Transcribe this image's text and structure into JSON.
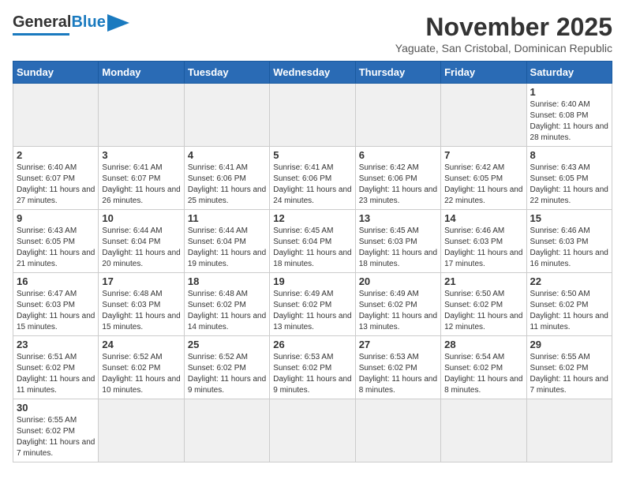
{
  "header": {
    "logo_general": "General",
    "logo_blue": "Blue",
    "month_title": "November 2025",
    "subtitle": "Yaguate, San Cristobal, Dominican Republic"
  },
  "weekdays": [
    "Sunday",
    "Monday",
    "Tuesday",
    "Wednesday",
    "Thursday",
    "Friday",
    "Saturday"
  ],
  "weeks": [
    [
      {
        "day": "",
        "empty": true
      },
      {
        "day": "",
        "empty": true
      },
      {
        "day": "",
        "empty": true
      },
      {
        "day": "",
        "empty": true
      },
      {
        "day": "",
        "empty": true
      },
      {
        "day": "",
        "empty": true
      },
      {
        "day": "1",
        "sunrise": "Sunrise: 6:40 AM",
        "sunset": "Sunset: 6:08 PM",
        "daylight": "Daylight: 11 hours and 28 minutes."
      }
    ],
    [
      {
        "day": "2",
        "sunrise": "Sunrise: 6:40 AM",
        "sunset": "Sunset: 6:07 PM",
        "daylight": "Daylight: 11 hours and 27 minutes."
      },
      {
        "day": "3",
        "sunrise": "Sunrise: 6:41 AM",
        "sunset": "Sunset: 6:07 PM",
        "daylight": "Daylight: 11 hours and 26 minutes."
      },
      {
        "day": "4",
        "sunrise": "Sunrise: 6:41 AM",
        "sunset": "Sunset: 6:06 PM",
        "daylight": "Daylight: 11 hours and 25 minutes."
      },
      {
        "day": "5",
        "sunrise": "Sunrise: 6:41 AM",
        "sunset": "Sunset: 6:06 PM",
        "daylight": "Daylight: 11 hours and 24 minutes."
      },
      {
        "day": "6",
        "sunrise": "Sunrise: 6:42 AM",
        "sunset": "Sunset: 6:06 PM",
        "daylight": "Daylight: 11 hours and 23 minutes."
      },
      {
        "day": "7",
        "sunrise": "Sunrise: 6:42 AM",
        "sunset": "Sunset: 6:05 PM",
        "daylight": "Daylight: 11 hours and 22 minutes."
      },
      {
        "day": "8",
        "sunrise": "Sunrise: 6:43 AM",
        "sunset": "Sunset: 6:05 PM",
        "daylight": "Daylight: 11 hours and 22 minutes."
      }
    ],
    [
      {
        "day": "9",
        "sunrise": "Sunrise: 6:43 AM",
        "sunset": "Sunset: 6:05 PM",
        "daylight": "Daylight: 11 hours and 21 minutes."
      },
      {
        "day": "10",
        "sunrise": "Sunrise: 6:44 AM",
        "sunset": "Sunset: 6:04 PM",
        "daylight": "Daylight: 11 hours and 20 minutes."
      },
      {
        "day": "11",
        "sunrise": "Sunrise: 6:44 AM",
        "sunset": "Sunset: 6:04 PM",
        "daylight": "Daylight: 11 hours and 19 minutes."
      },
      {
        "day": "12",
        "sunrise": "Sunrise: 6:45 AM",
        "sunset": "Sunset: 6:04 PM",
        "daylight": "Daylight: 11 hours and 18 minutes."
      },
      {
        "day": "13",
        "sunrise": "Sunrise: 6:45 AM",
        "sunset": "Sunset: 6:03 PM",
        "daylight": "Daylight: 11 hours and 18 minutes."
      },
      {
        "day": "14",
        "sunrise": "Sunrise: 6:46 AM",
        "sunset": "Sunset: 6:03 PM",
        "daylight": "Daylight: 11 hours and 17 minutes."
      },
      {
        "day": "15",
        "sunrise": "Sunrise: 6:46 AM",
        "sunset": "Sunset: 6:03 PM",
        "daylight": "Daylight: 11 hours and 16 minutes."
      }
    ],
    [
      {
        "day": "16",
        "sunrise": "Sunrise: 6:47 AM",
        "sunset": "Sunset: 6:03 PM",
        "daylight": "Daylight: 11 hours and 15 minutes."
      },
      {
        "day": "17",
        "sunrise": "Sunrise: 6:48 AM",
        "sunset": "Sunset: 6:03 PM",
        "daylight": "Daylight: 11 hours and 15 minutes."
      },
      {
        "day": "18",
        "sunrise": "Sunrise: 6:48 AM",
        "sunset": "Sunset: 6:02 PM",
        "daylight": "Daylight: 11 hours and 14 minutes."
      },
      {
        "day": "19",
        "sunrise": "Sunrise: 6:49 AM",
        "sunset": "Sunset: 6:02 PM",
        "daylight": "Daylight: 11 hours and 13 minutes."
      },
      {
        "day": "20",
        "sunrise": "Sunrise: 6:49 AM",
        "sunset": "Sunset: 6:02 PM",
        "daylight": "Daylight: 11 hours and 13 minutes."
      },
      {
        "day": "21",
        "sunrise": "Sunrise: 6:50 AM",
        "sunset": "Sunset: 6:02 PM",
        "daylight": "Daylight: 11 hours and 12 minutes."
      },
      {
        "day": "22",
        "sunrise": "Sunrise: 6:50 AM",
        "sunset": "Sunset: 6:02 PM",
        "daylight": "Daylight: 11 hours and 11 minutes."
      }
    ],
    [
      {
        "day": "23",
        "sunrise": "Sunrise: 6:51 AM",
        "sunset": "Sunset: 6:02 PM",
        "daylight": "Daylight: 11 hours and 11 minutes."
      },
      {
        "day": "24",
        "sunrise": "Sunrise: 6:52 AM",
        "sunset": "Sunset: 6:02 PM",
        "daylight": "Daylight: 11 hours and 10 minutes."
      },
      {
        "day": "25",
        "sunrise": "Sunrise: 6:52 AM",
        "sunset": "Sunset: 6:02 PM",
        "daylight": "Daylight: 11 hours and 9 minutes."
      },
      {
        "day": "26",
        "sunrise": "Sunrise: 6:53 AM",
        "sunset": "Sunset: 6:02 PM",
        "daylight": "Daylight: 11 hours and 9 minutes."
      },
      {
        "day": "27",
        "sunrise": "Sunrise: 6:53 AM",
        "sunset": "Sunset: 6:02 PM",
        "daylight": "Daylight: 11 hours and 8 minutes."
      },
      {
        "day": "28",
        "sunrise": "Sunrise: 6:54 AM",
        "sunset": "Sunset: 6:02 PM",
        "daylight": "Daylight: 11 hours and 8 minutes."
      },
      {
        "day": "29",
        "sunrise": "Sunrise: 6:55 AM",
        "sunset": "Sunset: 6:02 PM",
        "daylight": "Daylight: 11 hours and 7 minutes."
      }
    ],
    [
      {
        "day": "30",
        "sunrise": "Sunrise: 6:55 AM",
        "sunset": "Sunset: 6:02 PM",
        "daylight": "Daylight: 11 hours and 7 minutes."
      },
      {
        "day": "",
        "empty": true
      },
      {
        "day": "",
        "empty": true
      },
      {
        "day": "",
        "empty": true
      },
      {
        "day": "",
        "empty": true
      },
      {
        "day": "",
        "empty": true
      },
      {
        "day": "",
        "empty": true
      }
    ]
  ]
}
